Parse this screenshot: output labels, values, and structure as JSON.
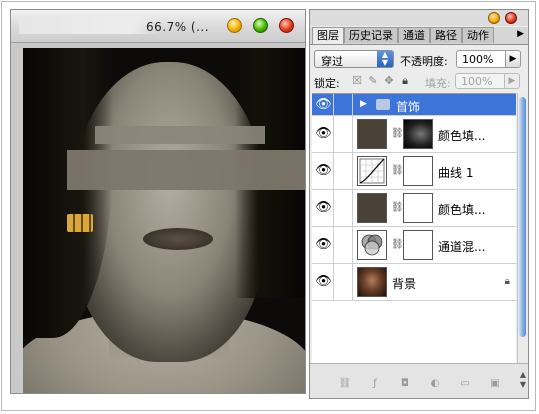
{
  "document": {
    "title_text": "66.7% (..."
  },
  "panel": {
    "tabs": [
      "图层",
      "历史记录",
      "通道",
      "路径",
      "动作"
    ],
    "tab_more_icon": "right-triangle-icon",
    "blend_mode": "穿过",
    "opacity_label": "不透明度:",
    "opacity_value": "100%",
    "lock_label": "锁定:",
    "fill_label": "填充:",
    "fill_value": "100%",
    "layers": [
      {
        "name": "首饰",
        "type": "group",
        "selected": true
      },
      {
        "name": "颜色填...",
        "type": "fill",
        "selected": false
      },
      {
        "name": "曲线 1",
        "type": "curves",
        "selected": false
      },
      {
        "name": "颜色填...",
        "type": "fill",
        "selected": false
      },
      {
        "name": "通道混...",
        "type": "channel-mixer",
        "selected": false
      },
      {
        "name": "背景",
        "type": "background",
        "selected": false
      }
    ]
  },
  "colors": {
    "selection": "#3c74d8",
    "fill_layer_thumb": "#4a4236"
  }
}
